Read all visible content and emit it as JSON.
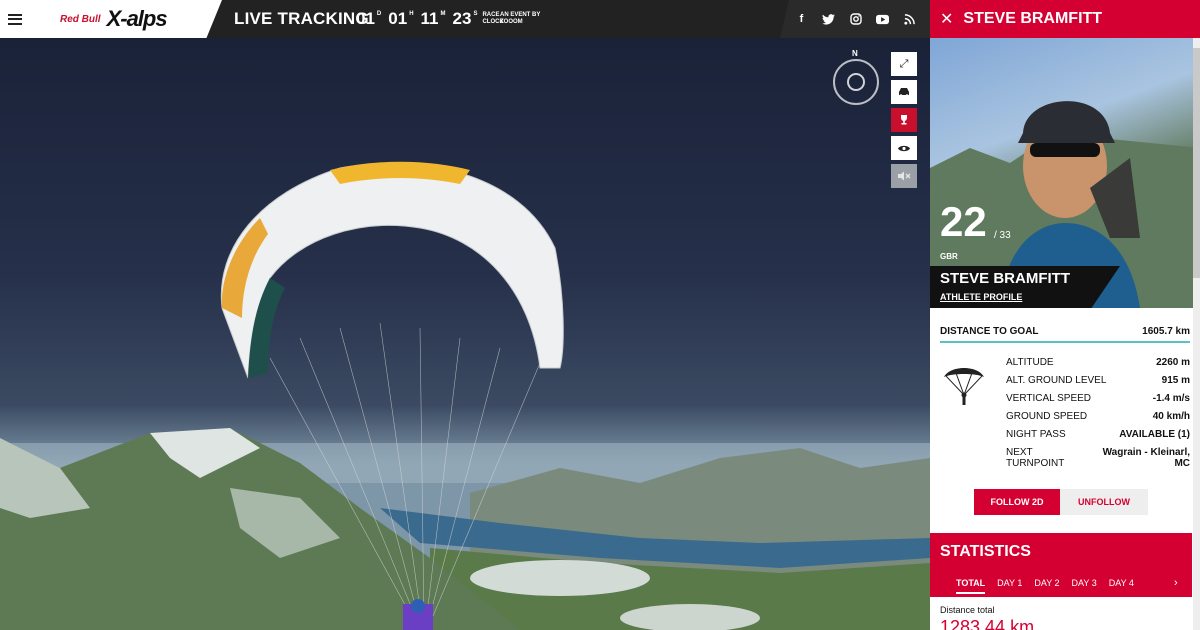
{
  "header": {
    "brand_small": "Red Bull",
    "brand_large": "X-alps",
    "live_tracking": "LIVE TRACKING",
    "clock": [
      {
        "value": "01",
        "unit": "D"
      },
      {
        "value": "01",
        "unit": "H"
      },
      {
        "value": "11",
        "unit": "M"
      },
      {
        "value": "23",
        "unit": "S"
      }
    ],
    "race_clock": "RACE CLOCK",
    "event_by": "AN EVENT BY ZOOOM"
  },
  "social_icons": [
    "facebook-icon",
    "twitter-icon",
    "instagram-icon",
    "youtube-icon",
    "rss-icon"
  ],
  "map_controls": {
    "compass_label": "N",
    "buttons": [
      "fullscreen-icon",
      "car-icon",
      "trophy-icon",
      "eye-icon",
      "mute-icon"
    ]
  },
  "panel": {
    "title": "STEVE BRAMFITT",
    "rank": "22",
    "rank_total": "/ 33",
    "nationality": "GBR",
    "athlete_name": "STEVE BRAMFITT",
    "athlete_profile_link": "ATHLETE PROFILE",
    "distance_to_goal_label": "DISTANCE TO GOAL",
    "distance_to_goal_value": "1605.7 km",
    "stats": [
      {
        "label": "ALTITUDE",
        "value": "2260 m"
      },
      {
        "label": "ALT. GROUND LEVEL",
        "value": "915 m"
      },
      {
        "label": "VERTICAL SPEED",
        "value": "-1.4 m/s"
      },
      {
        "label": "GROUND SPEED",
        "value": "40 km/h"
      },
      {
        "label": "NIGHT PASS",
        "value": "AVAILABLE (1)"
      },
      {
        "label": "NEXT TURNPOINT",
        "value": "Wagrain - Kleinarl, MC"
      }
    ],
    "follow_button": "FOLLOW 2D",
    "unfollow_button": "UNFOLLOW",
    "statistics_title": "STATISTICS",
    "tabs": [
      "TOTAL",
      "DAY 1",
      "DAY 2",
      "DAY 3",
      "DAY 4"
    ],
    "distance_total_label": "Distance total",
    "distance_total_value": "1283.44 km"
  },
  "colors": {
    "accent": "#d50032",
    "teal": "#5bc0c8"
  }
}
